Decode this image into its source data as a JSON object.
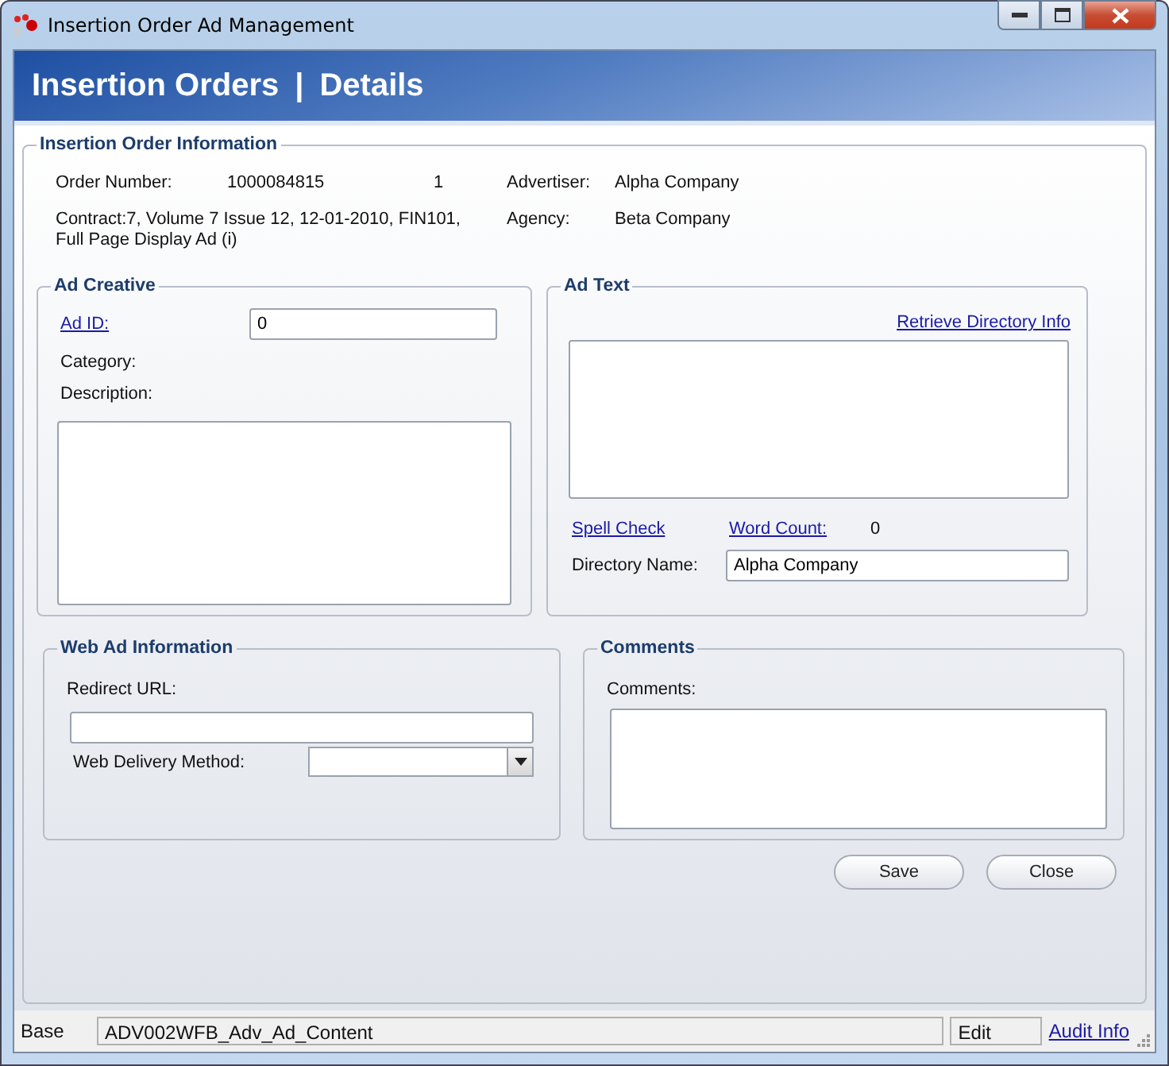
{
  "window": {
    "title": "Insertion Order Ad Management"
  },
  "header": {
    "section": "Insertion Orders",
    "separator": "|",
    "page": "Details"
  },
  "order_info": {
    "legend": "Insertion Order Information",
    "order_number": {
      "label": "Order Number:",
      "value": "1000084815",
      "line": "1"
    },
    "contract": {
      "text": "Contract:7, Volume 7 Issue 12, 12-01-2010, FIN101, Full Page Display Ad (i)"
    },
    "advertiser": {
      "label": "Advertiser:",
      "value": "Alpha Company"
    },
    "agency": {
      "label": "Agency:",
      "value": "Beta Company"
    }
  },
  "ad_creative": {
    "legend": "Ad Creative",
    "ad_id": {
      "label": "Ad ID:",
      "value": "0"
    },
    "category_label": "Category:",
    "description_label": "Description:"
  },
  "ad_text": {
    "legend": "Ad Text",
    "retrieve_link": "Retrieve Directory Info",
    "spell_check_link": "Spell Check",
    "word_count": {
      "label": "Word Count:",
      "value": "0"
    },
    "directory_name": {
      "label": "Directory Name:",
      "value": "Alpha Company"
    }
  },
  "web_ad": {
    "legend": "Web Ad Information",
    "redirect_label": "Redirect URL:",
    "delivery_label": "Web Delivery Method:"
  },
  "comments": {
    "legend": "Comments",
    "label": "Comments:"
  },
  "buttons": [
    "Save",
    "Close"
  ],
  "status_bar": {
    "mode": "Base",
    "form": "ADV002WFB_Adv_Ad_Content",
    "state": "Edit",
    "link": "Audit Info"
  }
}
